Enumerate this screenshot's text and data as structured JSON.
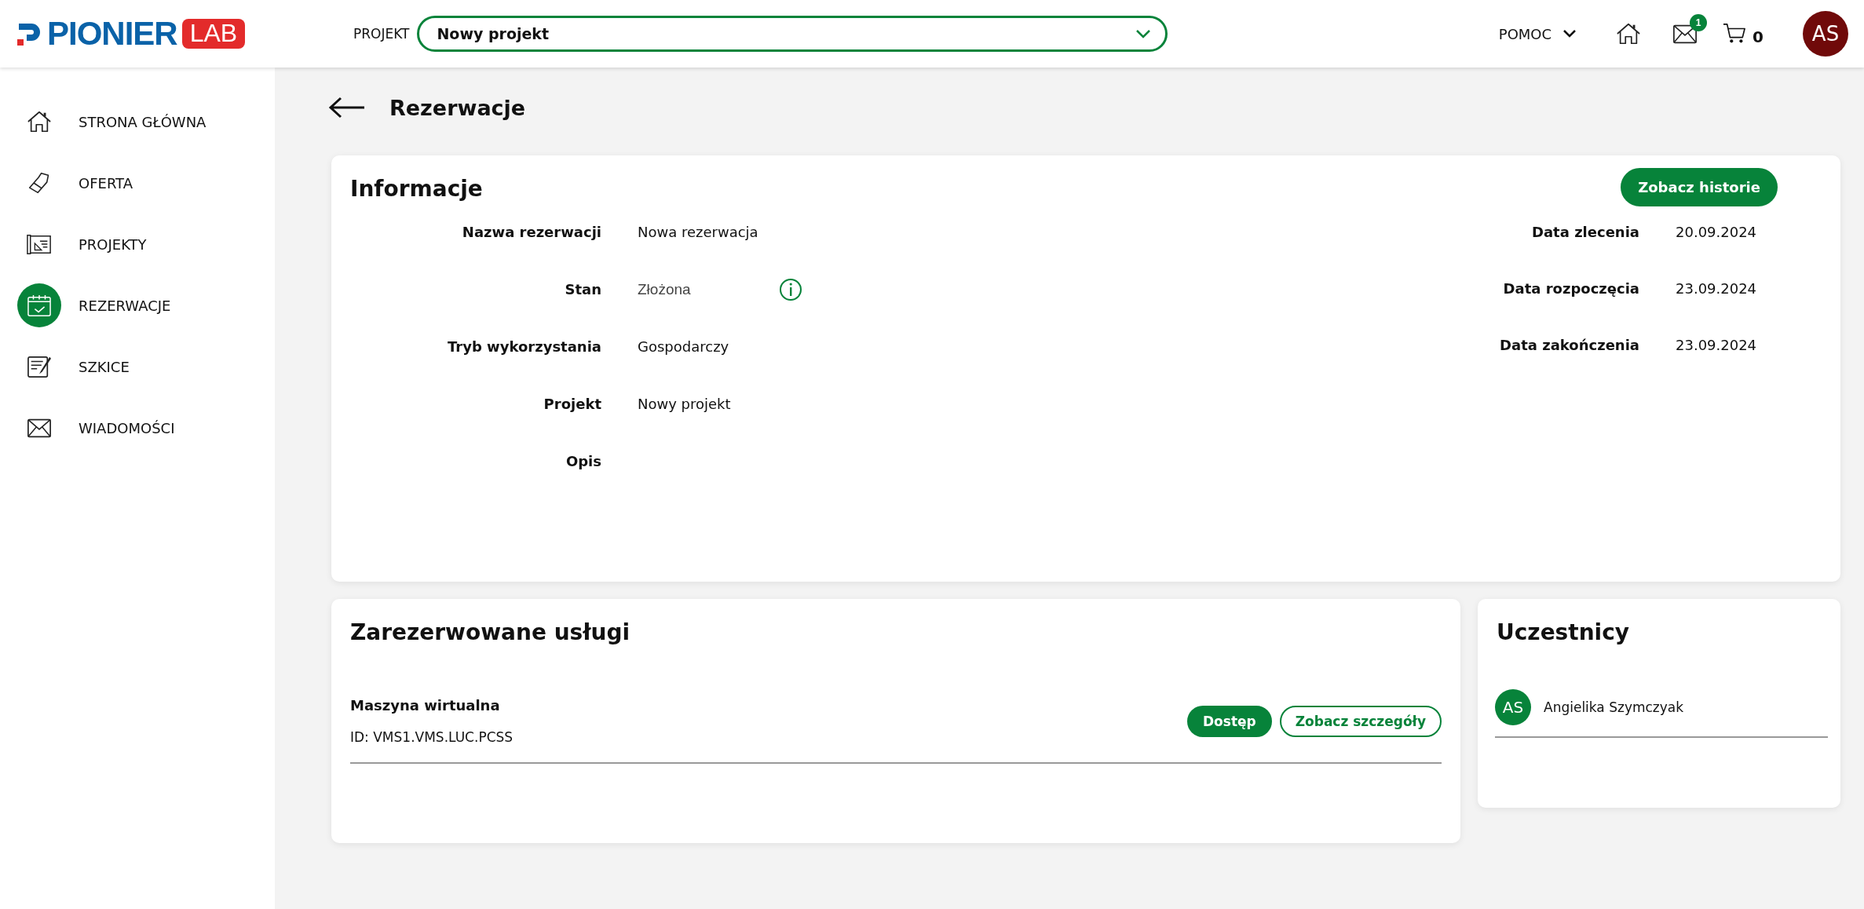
{
  "header": {
    "logo": {
      "text": "PIONIER",
      "badge": "LAB"
    },
    "project_label": "PROJEKT",
    "project_select": "Nowy projekt",
    "help_menu": "POMOC",
    "messages_badge": "1",
    "cart_count": "0",
    "avatar": "AS"
  },
  "sidebar": {
    "items": [
      {
        "kind": "home",
        "label": "STRONA GŁÓWNA",
        "selected": false
      },
      {
        "kind": "tag",
        "label": "OFERTA",
        "selected": false
      },
      {
        "kind": "blueprint",
        "label": "PROJEKTY",
        "selected": false
      },
      {
        "kind": "calendar",
        "label": "REZERWACJE",
        "selected": true
      },
      {
        "kind": "notes",
        "label": "SZKICE",
        "selected": false
      },
      {
        "kind": "mail",
        "label": "WIADOMOŚCI",
        "selected": false
      }
    ]
  },
  "page_title": "Rezerwacje",
  "info": {
    "title": "Informacje",
    "history_button": "Zobacz historie",
    "fields": [
      {
        "label": "Nazwa rezerwacji",
        "value": "Nowa rezerwacja"
      },
      {
        "label": "Stan",
        "value": "Złożona",
        "kind": "status"
      },
      {
        "label": "Tryb wykorzystania",
        "value": "Gospodarczy"
      },
      {
        "label": "Projekt",
        "value": "Nowy projekt"
      },
      {
        "label": "Opis"
      }
    ],
    "dates": [
      {
        "label": "Data zlecenia",
        "value": "20.09.2024"
      },
      {
        "label": "Data rozpoczęcia",
        "value": "23.09.2024"
      },
      {
        "label": "Data zakończenia",
        "value": "23.09.2024"
      }
    ]
  },
  "services": {
    "title": "Zarezerwowane usługi",
    "items": [
      {
        "name": "Maszyna wirtualna",
        "id": "ID: VMS1.VMS.LUC.PCSS",
        "access_button": "Dostęp",
        "details_button": "Zobacz szczegóły"
      }
    ]
  },
  "participants": {
    "title": "Uczestnicy",
    "items": [
      {
        "initials": "AS",
        "name": "Angielika Szymczyak"
      }
    ]
  }
}
